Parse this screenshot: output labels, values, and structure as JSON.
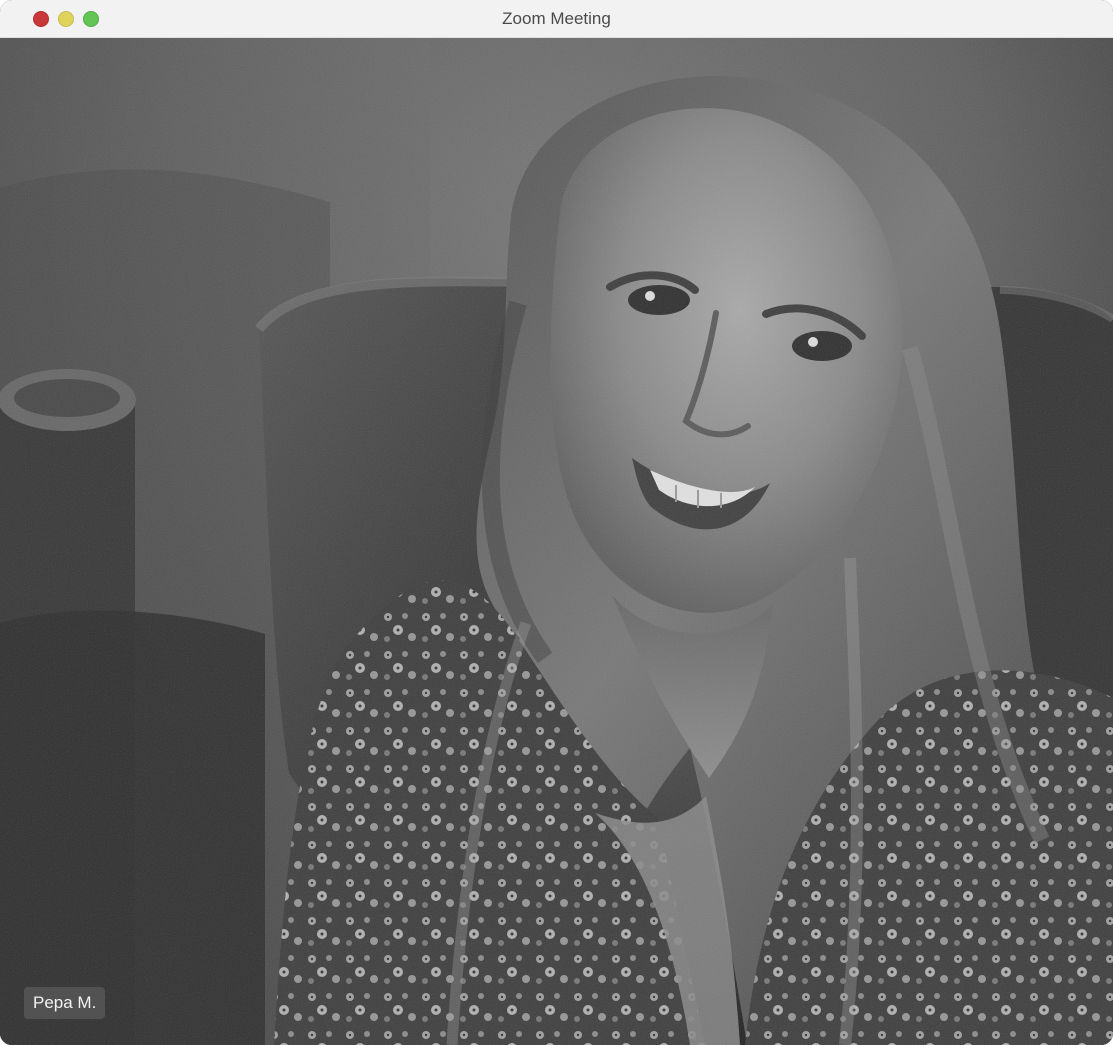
{
  "window": {
    "title": "Zoom Meeting",
    "controls": {
      "close_color": "#c9373a",
      "minimize_color": "#dfd35b",
      "zoom_color": "#62c554"
    }
  },
  "participant": {
    "name": "Pepa M."
  },
  "video": {
    "description_icon": "video-feed"
  }
}
